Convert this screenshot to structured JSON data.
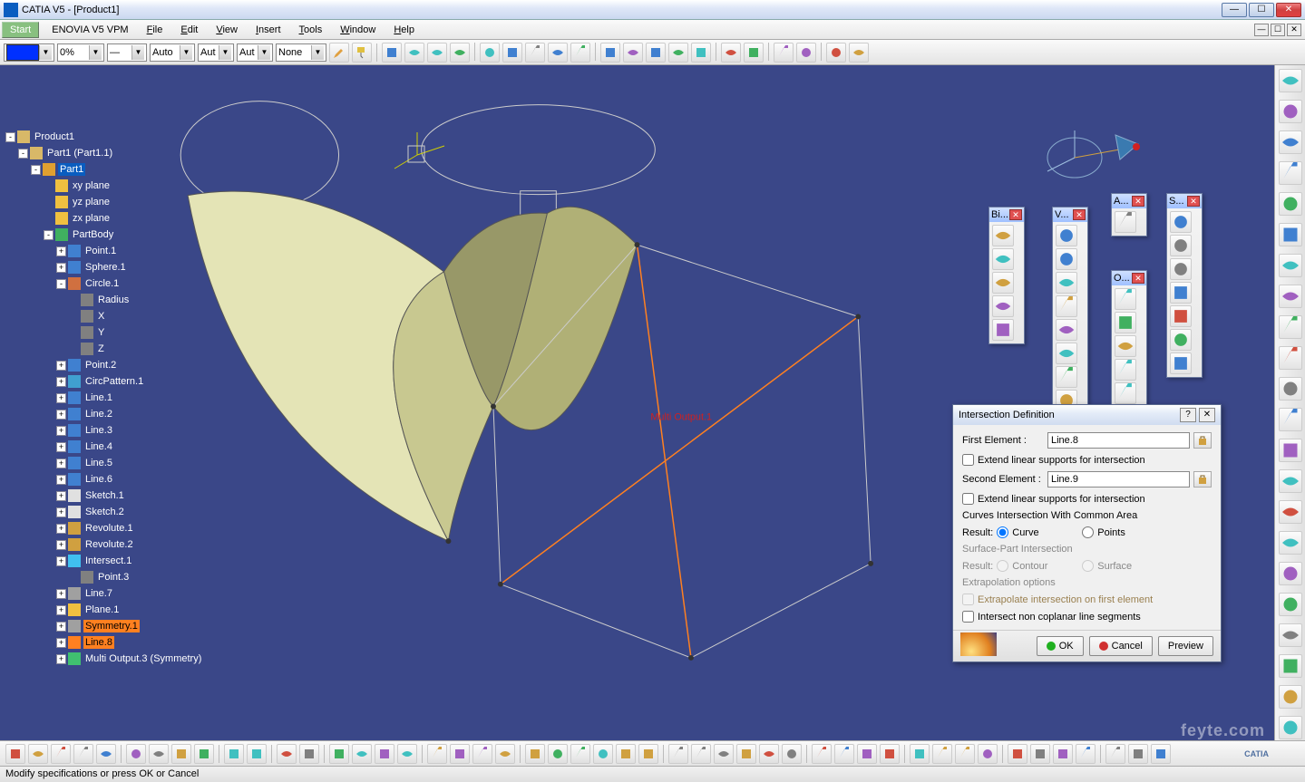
{
  "titlebar": {
    "title": "CATIA V5 - [Product1]"
  },
  "winbtns": {
    "min": "—",
    "max": "☐",
    "close": "✕"
  },
  "mdi": {
    "min": "—",
    "max": "☐",
    "close": "✕"
  },
  "menu": {
    "start": "Start",
    "enovia": "ENOVIA V5 VPM",
    "file": "File",
    "edit": "Edit",
    "view": "View",
    "insert": "Insert",
    "tools": "Tools",
    "window": "Window",
    "help": "Help"
  },
  "prop_toolbar": {
    "percent": "0%",
    "auto1": "Auto",
    "auto2": "Aut",
    "auto3": "Aut",
    "none": "None"
  },
  "tree": [
    {
      "d": 0,
      "exp": "-",
      "ic": "#d8b868",
      "t": "Product1"
    },
    {
      "d": 1,
      "exp": "-",
      "ic": "#d8b868",
      "t": "Part1 (Part1.1)"
    },
    {
      "d": 2,
      "exp": "-",
      "ic": "#e0a030",
      "t": "Part1",
      "sel": true
    },
    {
      "d": 3,
      "exp": "",
      "ic": "#f0c040",
      "t": " xy plane"
    },
    {
      "d": 3,
      "exp": "",
      "ic": "#f0c040",
      "t": " yz plane"
    },
    {
      "d": 3,
      "exp": "",
      "ic": "#f0c040",
      "t": " zx plane"
    },
    {
      "d": 3,
      "exp": "-",
      "ic": "#40b060",
      "t": "PartBody"
    },
    {
      "d": 4,
      "exp": "+",
      "ic": "#4080d0",
      "t": "Point.1"
    },
    {
      "d": 4,
      "exp": "+",
      "ic": "#4080d0",
      "t": "Sphere.1"
    },
    {
      "d": 4,
      "exp": "-",
      "ic": "#d07040",
      "t": "Circle.1"
    },
    {
      "d": 5,
      "exp": "",
      "ic": "#808080",
      "t": "Radius"
    },
    {
      "d": 5,
      "exp": "",
      "ic": "#808080",
      "t": "X"
    },
    {
      "d": 5,
      "exp": "",
      "ic": "#808080",
      "t": "Y"
    },
    {
      "d": 5,
      "exp": "",
      "ic": "#808080",
      "t": "Z"
    },
    {
      "d": 4,
      "exp": "+",
      "ic": "#4080d0",
      "t": "Point.2"
    },
    {
      "d": 4,
      "exp": "+",
      "ic": "#40a0d0",
      "t": "CircPattern.1"
    },
    {
      "d": 4,
      "exp": "+",
      "ic": "#4080d0",
      "t": "Line.1"
    },
    {
      "d": 4,
      "exp": "+",
      "ic": "#4080d0",
      "t": "Line.2"
    },
    {
      "d": 4,
      "exp": "+",
      "ic": "#4080d0",
      "t": "Line.3"
    },
    {
      "d": 4,
      "exp": "+",
      "ic": "#4080d0",
      "t": "Line.4"
    },
    {
      "d": 4,
      "exp": "+",
      "ic": "#4080d0",
      "t": "Line.5"
    },
    {
      "d": 4,
      "exp": "+",
      "ic": "#4080d0",
      "t": "Line.6"
    },
    {
      "d": 4,
      "exp": "+",
      "ic": "#e0e0e0",
      "t": "Sketch.1"
    },
    {
      "d": 4,
      "exp": "+",
      "ic": "#e0e0e0",
      "t": "Sketch.2"
    },
    {
      "d": 4,
      "exp": "+",
      "ic": "#d0a040",
      "t": "Revolute.1"
    },
    {
      "d": 4,
      "exp": "+",
      "ic": "#d0a040",
      "t": "Revolute.2"
    },
    {
      "d": 4,
      "exp": "+",
      "ic": "#40c0f0",
      "t": "Intersect.1"
    },
    {
      "d": 5,
      "exp": "",
      "ic": "#808080",
      "t": "Point.3"
    },
    {
      "d": 4,
      "exp": "+",
      "ic": "#a0a0a0",
      "t": "Line.7"
    },
    {
      "d": 4,
      "exp": "+",
      "ic": "#f0c040",
      "t": "Plane.1"
    },
    {
      "d": 4,
      "exp": "+",
      "ic": "#a0a0a0",
      "t": "Symmetry.1",
      "hl": true
    },
    {
      "d": 4,
      "exp": "+",
      "ic": "#ff8020",
      "t": "Line.8",
      "hl": true
    },
    {
      "d": 4,
      "exp": "+",
      "ic": "#40c070",
      "t": "Multi Output.3 (Symmetry)"
    }
  ],
  "viewport_annotation": "Multi Output.1",
  "float_toolbars": {
    "bi": {
      "title": "Bi..."
    },
    "v": {
      "title": "V..."
    },
    "a": {
      "title": "A..."
    },
    "s": {
      "title": "S..."
    },
    "o": {
      "title": "O..."
    }
  },
  "dialog": {
    "title": "Intersection Definition",
    "first_label": "First Element :",
    "first_val": "Line.8",
    "chk1": "Extend linear supports for intersection",
    "second_label": "Second Element :",
    "second_val": "Line.9",
    "chk2": "Extend linear supports for intersection",
    "sec_curves": "Curves Intersection With Common Area",
    "result_label": "Result:",
    "curve": "Curve",
    "points": "Points",
    "sec_surface": "Surface-Part Intersection",
    "contour": "Contour",
    "surface": "Surface",
    "sec_extrap": "Extrapolation options",
    "chk_extrap": "Extrapolate intersection on first element",
    "chk_noncop": "Intersect non coplanar line segments",
    "ok": "OK",
    "cancel": "Cancel",
    "preview": "Preview"
  },
  "status": "Modify specifications or press OK or Cancel",
  "watermark": "feyte.com",
  "logo": "CATIA"
}
